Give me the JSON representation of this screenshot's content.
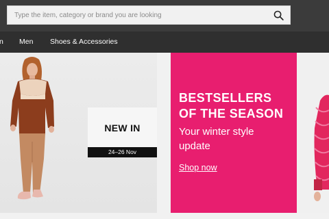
{
  "search": {
    "placeholder": "Type the item, category or brand you are looking"
  },
  "nav": {
    "items": [
      {
        "label": "n"
      },
      {
        "label": "Men"
      },
      {
        "label": "Shoes & Accessories"
      }
    ]
  },
  "banners": {
    "new_in": {
      "title": "NEW IN",
      "date": "24–26 Nov"
    },
    "promo": {
      "title_line1": "BESTSELLERS",
      "title_line2": "OF THE SEASON",
      "subtitle_line1": "Your winter style",
      "subtitle_line2": "update",
      "cta": "Shop now",
      "background_color": "#e81e6f"
    }
  },
  "colors": {
    "topbar": "#3b3b3b",
    "navbar": "#2f2f2f",
    "accent_pink": "#e81e6f"
  }
}
